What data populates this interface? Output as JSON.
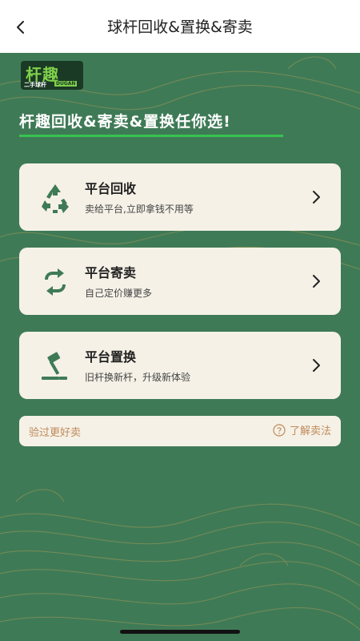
{
  "header": {
    "title": "球杆回收&置换&寄卖"
  },
  "logo": {
    "main": "杆趣",
    "sub": "二手球杆",
    "tag": "DUGAN"
  },
  "headline": "杆趣回收&寄卖&置换任你选!",
  "cards": [
    {
      "icon": "recycle-icon",
      "title": "平台回收",
      "subtitle": "卖给平台,立即拿钱不用等"
    },
    {
      "icon": "exchange-arrows-icon",
      "title": "平台寄卖",
      "subtitle": "自己定价赚更多"
    },
    {
      "icon": "auction-hammer-icon",
      "title": "平台置换",
      "subtitle": "旧杆换新杆，升级新体验"
    }
  ],
  "tip": {
    "left": "验过更好卖",
    "right": "了解卖法"
  },
  "colors": {
    "background": "#3f7a56",
    "card": "#f5f1e7",
    "accent": "#37c34f",
    "tip_text": "#c08a5a",
    "icon_green": "#3f7a56"
  }
}
